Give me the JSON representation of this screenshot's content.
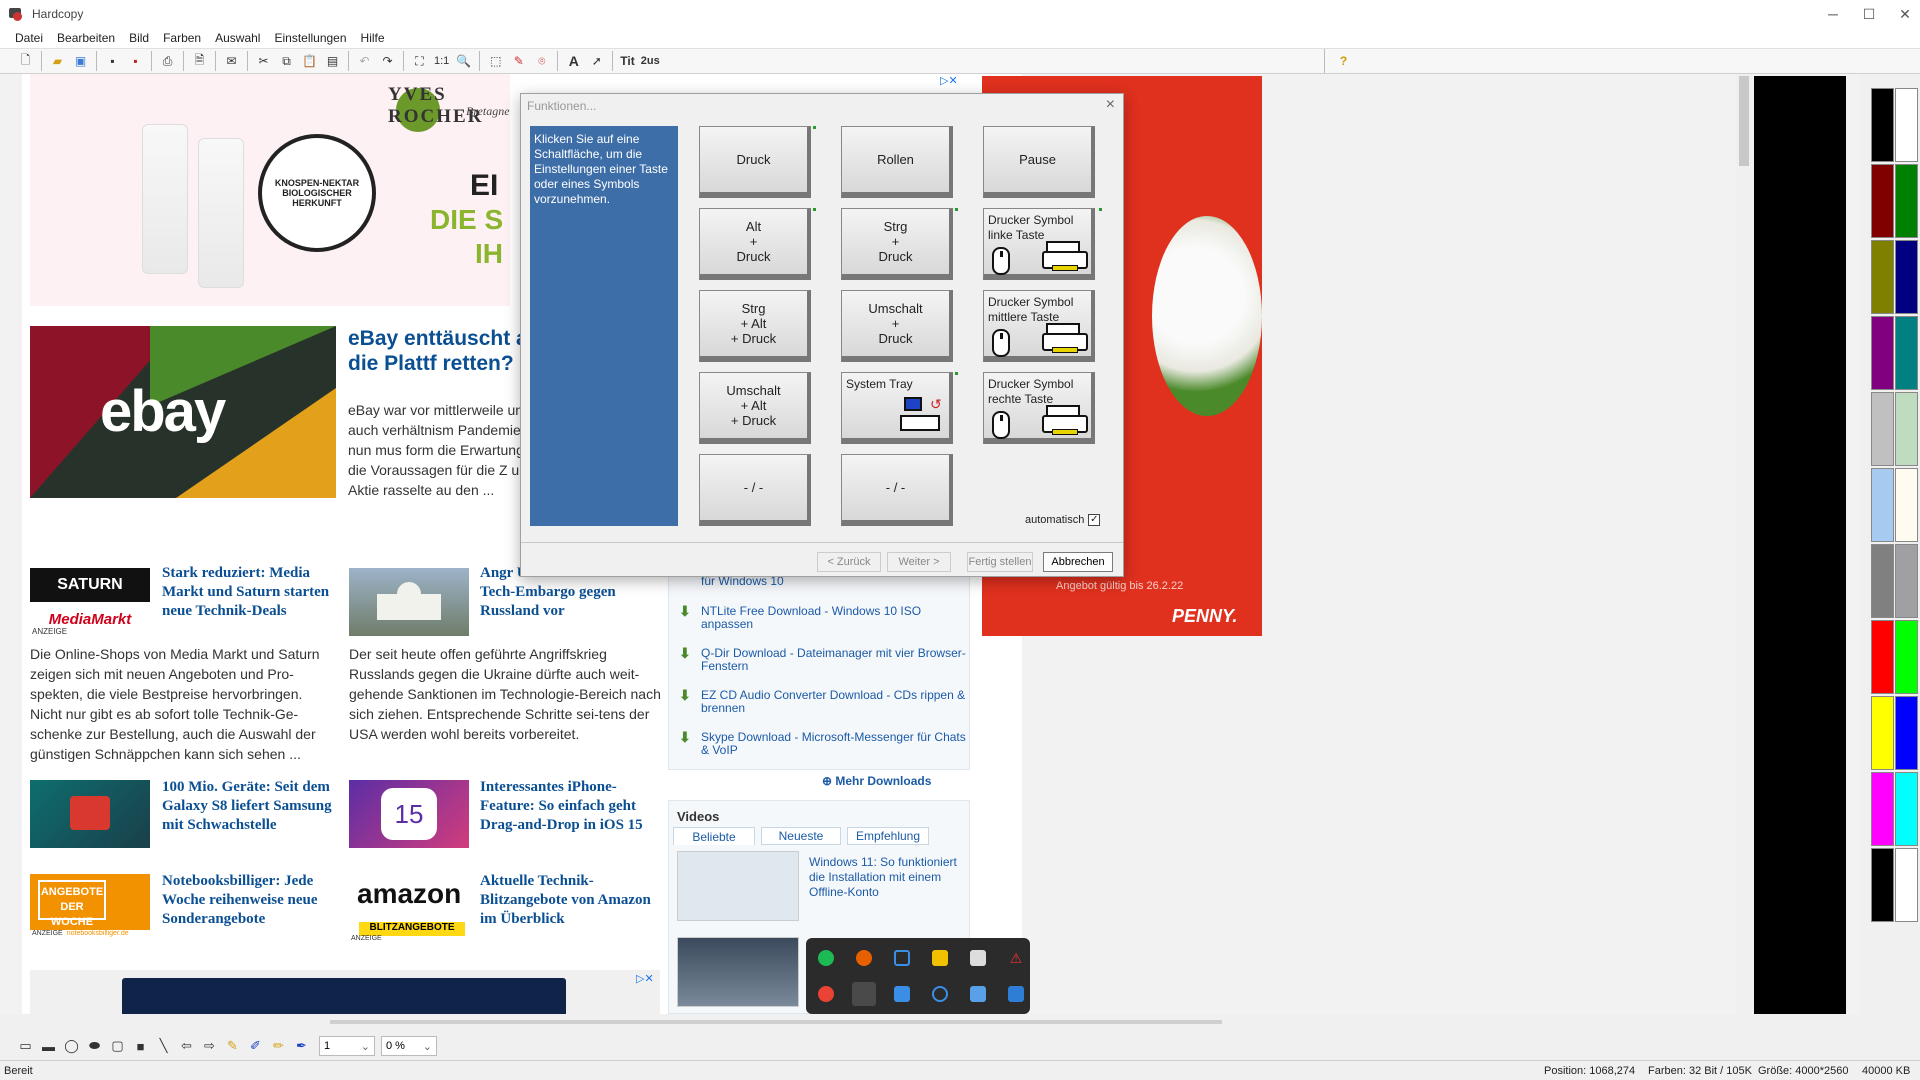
{
  "window": {
    "title": "Hardcopy"
  },
  "menu": [
    "Datei",
    "Bearbeiten",
    "Bild",
    "Farben",
    "Auswahl",
    "Einstellungen",
    "Hilfe"
  ],
  "toolbar": {
    "zoom_label": "1:1",
    "text_tool1": "Tit",
    "text_tool2": "2us",
    "text_a": "A"
  },
  "webpage": {
    "ad_top": {
      "brand": "YVES ROCHER",
      "brand_sub": "Bretagne",
      "seal": "KNOSPEN-NEKTAR BIOLOGISCHER HERKUNFT",
      "head1": "EI",
      "head2": "DIE S",
      "head3": "IH"
    },
    "hero": {
      "logo": "ebay",
      "title": "eBay enttäuscht ab: Ist die Plattf retten?",
      "text": "eBay war vor mittlerweile und kam auch verhältnism Pandemie. Doch nun mus form die Erwartungen krä die Voraussagen für die Z und die Aktie rasselte au den ..."
    },
    "articles": [
      {
        "title": "Stark reduziert: Media Markt und Saturn starten neue Technik-Deals",
        "thumb": "SATURN",
        "thumb2": "MediaMarkt",
        "badge": "ANZEIGE",
        "text": "Die Online-Shops von Media Markt und Saturn zeigen sich mit neuen Angeboten und Pro-spekten, die viele Bestpreise hervorbringen. Nicht nur gibt es ab sofort tolle Technik-Ge-schenke zur Bestellung, auch die Auswahl der günstigen Schnäppchen kann sich sehen ..."
      },
      {
        "title": "Angr Ukraine: USA bereiten Tech-Embargo gegen Russland vor",
        "text": "Der seit heute offen geführte Angriffskrieg Russlands gegen die Ukraine dürfte auch weit-gehende Sanktionen im Technologie-Bereich nach sich ziehen. Entsprechende Schritte sei-tens der USA werden wohl bereits vorbereitet."
      },
      {
        "title": "100 Mio. Geräte: Seit dem Galaxy S8 liefert Samsung mit Schwachstelle"
      },
      {
        "title": "Interessantes iPhone-Feature: So einfach geht Drag-and-Drop in iOS 15",
        "thumb": "15"
      },
      {
        "title": "Notebooksbilliger: Jede Woche reihenweise neue Sonderangebote",
        "thumb": "ANGEBOTE DER WOCHE",
        "badge": "ANZEIGE",
        "badge2": "notebooksbilliger.de"
      },
      {
        "title": "Aktuelle Technik-Blitzangebote von Amazon im Überblick",
        "thumb": "amazon",
        "thumb2": "BLITZANGEBOTE",
        "badge": "ANZEIGE"
      }
    ],
    "downloads": [
      "für Windows 10",
      "NTLite Free Download - Windows 10 ISO anpassen",
      "Q-Dir Download - Dateimanager mit vier Browser-Fenstern",
      "EZ CD Audio Converter Download - CDs rippen & brennen",
      "Skype Download - Microsoft-Messenger für Chats & VoIP"
    ],
    "more_downloads": "Mehr Downloads",
    "videos": {
      "heading": "Videos",
      "tabs": [
        "Beliebte",
        "Neueste",
        "Empfehlung"
      ],
      "items": [
        "Windows 11: So funktioniert die Installation mit einem Offline-Konto"
      ]
    },
    "penny": {
      "valid": "Angebot gültig bis 26.2.22",
      "logo": "PENNY."
    }
  },
  "dialog": {
    "title": "Funktionen...",
    "info": "Klicken Sie auf eine Schaltfläche, um die Einstellungen einer Taste oder eines Symbols vorzunehmen.",
    "keys": {
      "druck": "Druck",
      "rollen": "Rollen",
      "pause": "Pause",
      "alt_druck": "Alt\n+\nDruck",
      "strg_druck": "Strg\n+\nDruck",
      "drucker_links": "Drucker Symbol linke Taste",
      "strg_alt_druck": "Strg\n+ Alt\n+ Druck",
      "umschalt_druck": "Umschalt\n+\nDruck",
      "drucker_mitte": "Drucker Symbol mittlere Taste",
      "umschalt_alt_druck": "Umschalt\n+ Alt\n+ Druck",
      "system_tray": "System Tray",
      "drucker_rechts": "Drucker Symbol rechte Taste",
      "empty1": "- / -",
      "empty2": "- / -"
    },
    "automatic_label": "automatisch",
    "automatic_checked": true,
    "buttons": {
      "back": "< Zurück",
      "next": "Weiter >",
      "finish": "Fertig stellen",
      "cancel": "Abbrechen"
    }
  },
  "drawbar": {
    "line_width": "1",
    "opacity": "0 %"
  },
  "status": {
    "ready": "Bereit",
    "position": "Position: 1068,274",
    "colors": "Farben: 32 Bit / 105K",
    "size": "Größe: 4000*2560",
    "memory": "40000 KB"
  },
  "palette_colors": [
    "#000000",
    "#ffffff",
    "#800000",
    "#008000",
    "#808000",
    "#000080",
    "#800080",
    "#008080",
    "#c0c0c0",
    "#c0dcc0",
    "#a6caf0",
    "#fffbf0",
    "#808080",
    "#a0a0a4",
    "#ff0000",
    "#00ff00",
    "#ffff00",
    "#0000ff",
    "#ff00ff",
    "#00ffff",
    "#000000",
    "#ffffff"
  ]
}
